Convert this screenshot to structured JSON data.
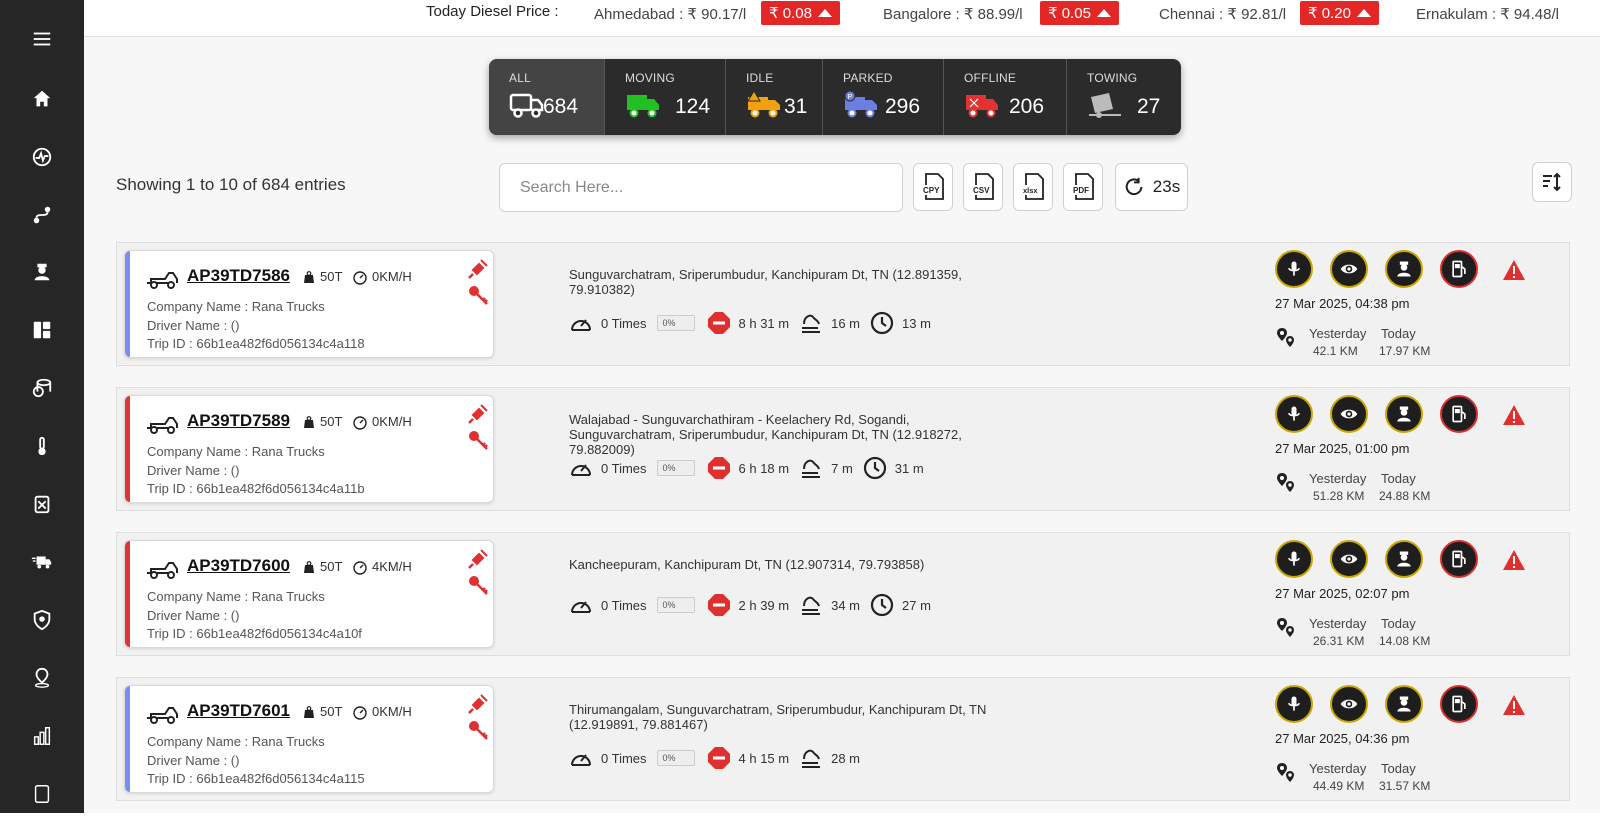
{
  "diesel": {
    "label": "Today Diesel Price :",
    "prices": [
      {
        "city": "Ahmedabad : ₹ 90.17/l",
        "change": "₹ 0.08"
      },
      {
        "city": "Bangalore : ₹ 88.99/l",
        "change": "₹ 0.05"
      },
      {
        "city": "Chennai : ₹ 92.81/l",
        "change": "₹ 0.20"
      },
      {
        "city": "Ernakulam : ₹ 94.48/l",
        "change": ""
      }
    ]
  },
  "status": [
    {
      "label": "ALL",
      "count": "684",
      "color": "#ffffff"
    },
    {
      "label": "MOVING",
      "count": "124",
      "color": "#22c022"
    },
    {
      "label": "IDLE",
      "count": "31",
      "color": "#f0a010"
    },
    {
      "label": "PARKED",
      "count": "296",
      "color": "#6b7fe0"
    },
    {
      "label": "OFFLINE",
      "count": "206",
      "color": "#e23232"
    },
    {
      "label": "TOWING",
      "count": "27",
      "color": "#bbbbbb"
    }
  ],
  "toolbar": {
    "showing": "Showing 1 to 10 of 684 entries",
    "search_placeholder": "Search Here...",
    "copy": "CPY",
    "csv": "CSV",
    "xlsx": "xlsx",
    "pdf": "PDF",
    "refresh": "23s"
  },
  "vehicles": [
    {
      "plate": "AP39TD7586",
      "capacity": "50T",
      "speed": "0KM/H",
      "company": "Company Name : Rana Trucks",
      "driver": "Driver Name : ()",
      "trip": "Trip ID : 66b1ea482f6d056134c4a118",
      "accent": "#7b8ef0",
      "address": "Sunguvarchatram, Sriperumbudur, Kanchipuram Dt, TN (12.891359, 79.910382)",
      "times": "0 Times",
      "pct": "0%",
      "stop": "8 h 31 m",
      "idle": "16 m",
      "clock": "13 m",
      "timestamp": "27 Mar 2025, 04:38 pm",
      "yesterday": "42.1 KM",
      "today": "17.97 KM"
    },
    {
      "plate": "AP39TD7589",
      "capacity": "50T",
      "speed": "0KM/H",
      "company": "Company Name : Rana Trucks",
      "driver": "Driver Name : ()",
      "trip": "Trip ID : 66b1ea482f6d056134c4a11b",
      "accent": "#e23232",
      "address": "Walajabad - Sunguvarchathiram - Keelachery Rd, Sogandi, Sunguvarchatram, Sriperumbudur, Kanchipuram Dt, TN (12.918272, 79.882009)",
      "times": "0 Times",
      "pct": "0%",
      "stop": "6 h 18 m",
      "idle": "7 m",
      "clock": "31 m",
      "timestamp": "27 Mar 2025, 01:00 pm",
      "yesterday": "51.28 KM",
      "today": "24.88 KM"
    },
    {
      "plate": "AP39TD7600",
      "capacity": "50T",
      "speed": "4KM/H",
      "company": "Company Name : Rana Trucks",
      "driver": "Driver Name : ()",
      "trip": "Trip ID : 66b1ea482f6d056134c4a10f",
      "accent": "#e23232",
      "address": "Kancheepuram, Kanchipuram Dt, TN (12.907314, 79.793858)",
      "times": "0 Times",
      "pct": "0%",
      "stop": "2 h 39 m",
      "idle": "34 m",
      "clock": "27 m",
      "timestamp": "27 Mar 2025, 02:07 pm",
      "yesterday": "26.31 KM",
      "today": "14.08 KM"
    },
    {
      "plate": "AP39TD7601",
      "capacity": "50T",
      "speed": "0KM/H",
      "company": "Company Name : Rana Trucks",
      "driver": "Driver Name : ()",
      "trip": "Trip ID : 66b1ea482f6d056134c4a115",
      "accent": "#7b8ef0",
      "address": "Thirumangalam, Sunguvarchatram, Sriperumbudur, Kanchipuram Dt, TN (12.919891, 79.881467)",
      "times": "0 Times",
      "pct": "0%",
      "stop": "4 h 15 m",
      "idle": "28 m",
      "clock": "",
      "timestamp": "27 Mar 2025, 04:36 pm",
      "yesterday": "44.49 KM",
      "today": "31.57 KM"
    }
  ],
  "labels": {
    "yesterday": "Yesterday",
    "today": "Today"
  },
  "icons": {
    "sidebar": [
      "menu-icon",
      "home-icon",
      "activity-icon",
      "route-icon",
      "driver-icon",
      "dashboard-icon",
      "fuel-stack-icon",
      "temperature-icon",
      "fuel-pump-icon",
      "truck-fast-icon",
      "shield-icon",
      "location-pin-icon",
      "bar-chart-icon",
      "report-icon"
    ],
    "row_actions": [
      "microphone-icon",
      "eye-icon",
      "driver-icon",
      "fuel-station-icon"
    ]
  }
}
